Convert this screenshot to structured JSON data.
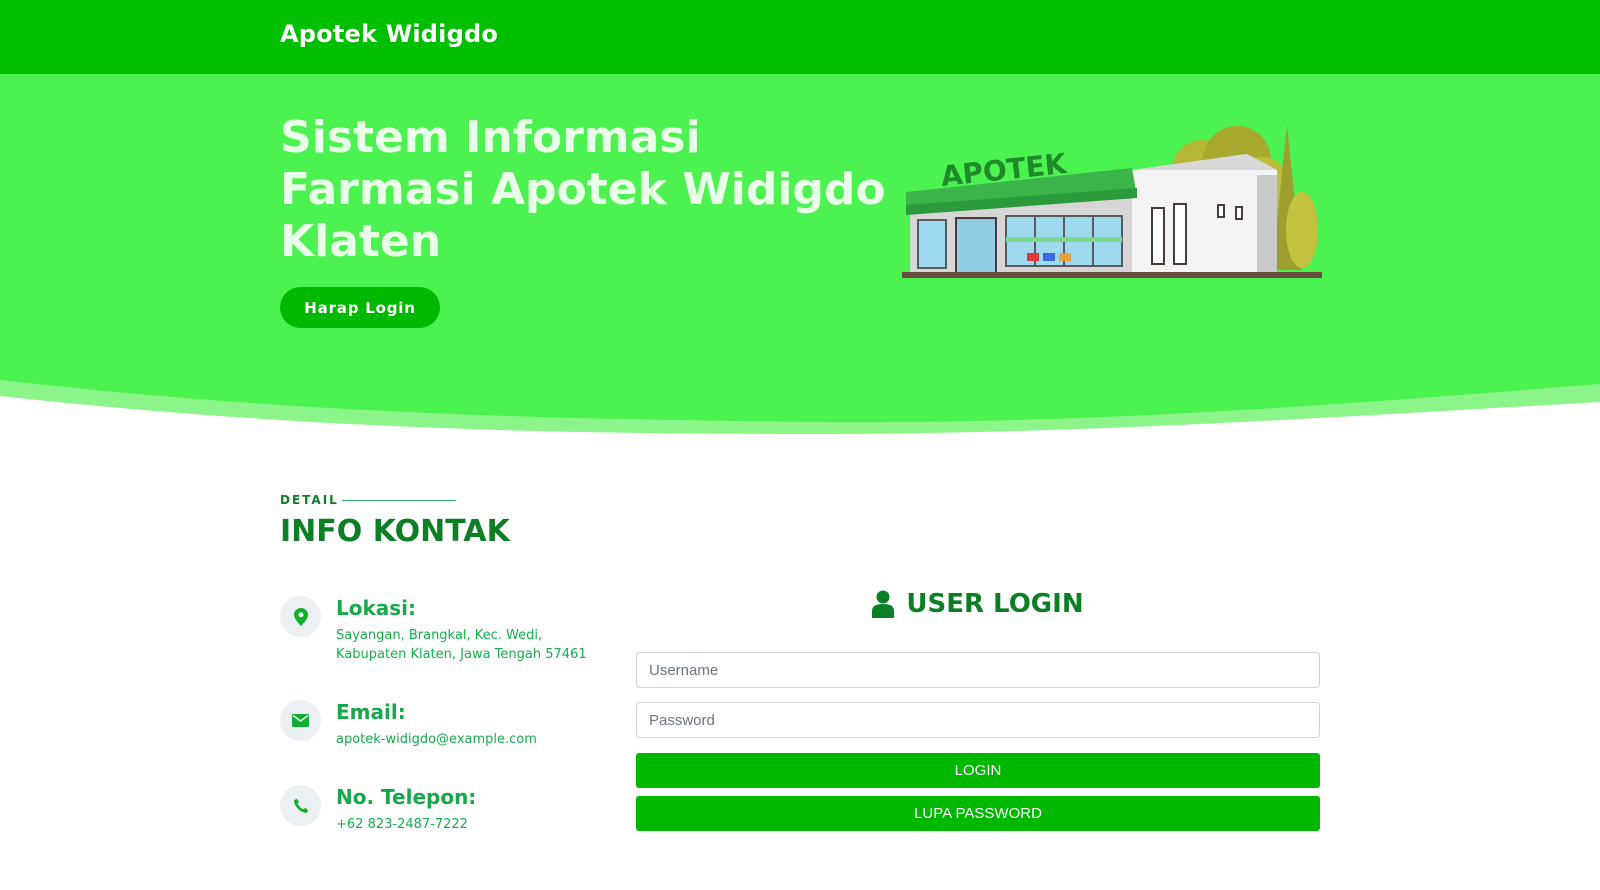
{
  "header": {
    "brand": "Apotek Widigdo"
  },
  "hero": {
    "title": "Sistem Informasi Farmasi Apotek Widigdo Klaten",
    "button_label": "Harap Login",
    "illustration_sign": "APOTEK"
  },
  "contact": {
    "kicker": "DETAIL",
    "title": "INFO KONTAK",
    "items": [
      {
        "label": "Lokasi:",
        "value": "Sayangan, Brangkal, Kec. Wedi, Kabupaten Klaten, Jawa Tengah 57461",
        "icon": "location-pin-icon"
      },
      {
        "label": "Email:",
        "value": "apotek-widigdo@example.com",
        "icon": "envelope-icon"
      },
      {
        "label": "No. Telepon:",
        "value": "+62 823-2487-7222",
        "icon": "phone-icon"
      }
    ]
  },
  "login": {
    "title": "USER LOGIN",
    "icon": "user-icon",
    "username_placeholder": "Username",
    "password_placeholder": "Password",
    "login_label": "LOGIN",
    "forgot_label": "LUPA PASSWORD"
  },
  "colors": {
    "header_green": "#00be00",
    "hero_green": "#4cf24f",
    "button_green": "#00b800",
    "heading_green": "#0a7f24",
    "text_green": "#10b04a"
  }
}
